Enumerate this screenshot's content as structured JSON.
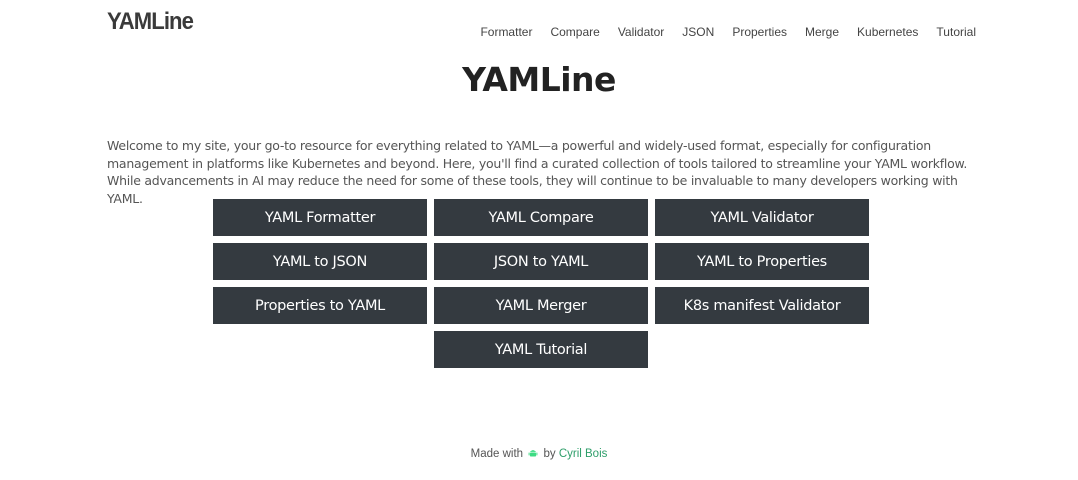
{
  "header": {
    "logo": "YAMLine",
    "nav": [
      "Formatter",
      "Compare",
      "Validator",
      "JSON",
      "Properties",
      "Merge",
      "Kubernetes",
      "Tutorial"
    ]
  },
  "main": {
    "title": "YAMLine",
    "intro": "Welcome to my site, your go-to resource for everything related to YAML—a powerful and widely-used format, especially for configuration management in platforms like Kubernetes and beyond. Here, you'll find a curated collection of tools tailored to streamline your YAML workflow. While advancements in AI may reduce the need for some of these tools, they will continue to be invaluable to many developers working with YAML.",
    "tools": [
      "YAML Formatter",
      "YAML Compare",
      "YAML Validator",
      "YAML to JSON",
      "JSON to YAML",
      "YAML to Properties",
      "Properties to YAML",
      "YAML Merger",
      "K8s manifest Validator",
      "YAML Tutorial"
    ]
  },
  "footer": {
    "made_with": "Made with",
    "icon": "android-icon",
    "by": "by",
    "author": "Cyril Bois",
    "author_color": "#2e9e6a"
  },
  "colors": {
    "button_bg": "#343a40",
    "button_text": "#ffffff"
  }
}
